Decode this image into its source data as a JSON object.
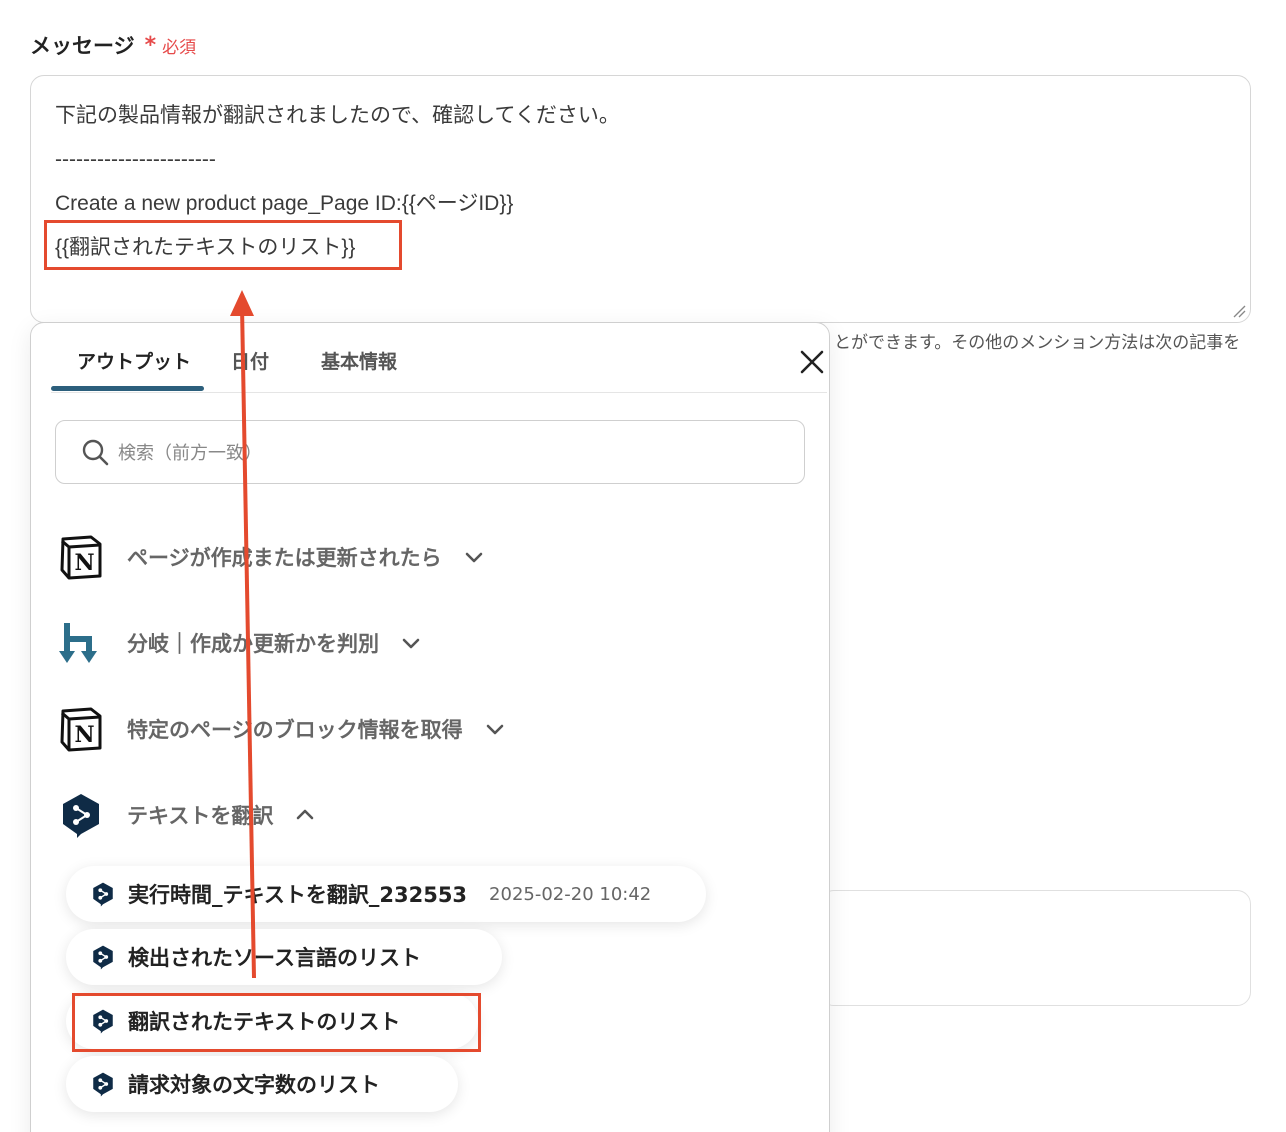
{
  "field": {
    "label": "メッセージ",
    "asterisk": "*",
    "required": "必須"
  },
  "message": {
    "lines": [
      "下記の製品情報が翻訳されましたので、確認してください。",
      "-----------------------",
      "Create a new product page_Page ID:{{ページID}}",
      "{{翻訳されたテキストのリスト}}"
    ]
  },
  "hint": "とができます。その他のメンション方法は次の記事を",
  "popup": {
    "tabs": [
      "アウトプット",
      "日付",
      "基本情報"
    ],
    "search_placeholder": "検索（前方一致）",
    "sections": [
      {
        "label": "ページが作成または更新されたら",
        "icon": "notion-icon",
        "expanded": false
      },
      {
        "label": "分岐｜作成か更新かを判別",
        "icon": "branch-icon",
        "expanded": false
      },
      {
        "label": "特定のページのブロック情報を取得",
        "icon": "notion-icon",
        "expanded": false
      },
      {
        "label": "テキストを翻訳",
        "icon": "deepl-icon",
        "expanded": true
      }
    ],
    "items": [
      {
        "label": "実行時間_テキストを翻訳_232553",
        "meta": "2025-02-20 10:42"
      },
      {
        "label": "検出されたソース言語のリスト",
        "meta": ""
      },
      {
        "label": "翻訳されたテキストのリスト",
        "meta": ""
      },
      {
        "label": "請求対象の文字数のリスト",
        "meta": ""
      }
    ]
  },
  "colors": {
    "highlight": "#e44a2e",
    "accent": "#2c5f7c",
    "required": "#e64a4a"
  }
}
